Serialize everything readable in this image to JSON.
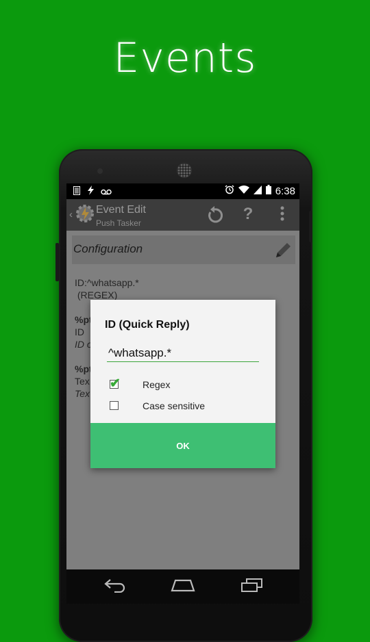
{
  "headline": "Events",
  "status_bar": {
    "time": "6:38"
  },
  "action_bar": {
    "title": "Event Edit",
    "subtitle": "Push Tasker",
    "icons": [
      "back-chevron-icon",
      "tasker-logo-icon",
      "undo-icon",
      "help-icon",
      "overflow-menu-icon"
    ]
  },
  "screen": {
    "section_title": "Configuration",
    "line1": "ID:^whatsapp.*",
    "line2": " (REGEX)",
    "param1_title": "%pt",
    "param1_label": "ID",
    "param1_desc": "ID o",
    "param2_title": "%pt",
    "param2_label": "Tex",
    "param2_desc": "Tex"
  },
  "dialog": {
    "title": "ID (Quick Reply)",
    "input_value": "^whatsapp.*",
    "regex_label": "Regex",
    "regex_checked": true,
    "case_label": "Case sensitive",
    "case_checked": false,
    "ok_label": "OK"
  },
  "colors": {
    "background": "#0b9a0d",
    "accent_green": "#3ebf73",
    "input_underline": "#3aa43a"
  }
}
